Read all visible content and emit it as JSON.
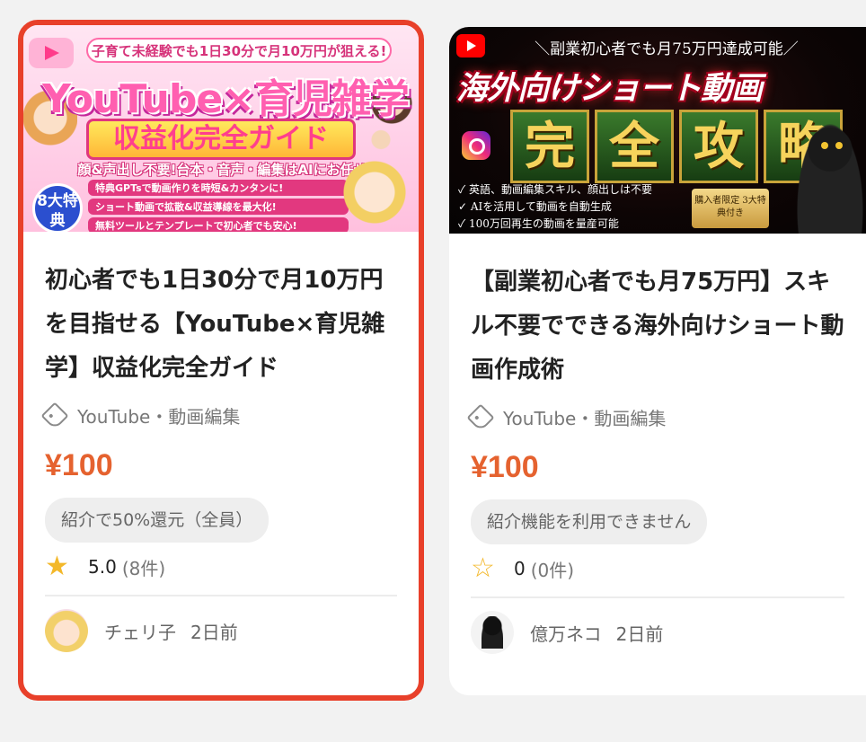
{
  "cards": [
    {
      "selected": true,
      "thumbnail": {
        "top_line": "子育て未経験でも1日30分で月10万円が狙える!",
        "headline": "YouTube×育児雑学",
        "subheadline": "収益化完全ガイド",
        "tagline": "顔&声出し不要!台本・音声・編集はAIにお任せ!",
        "badge": "8大特典",
        "bullets": [
          "特典GPTsで動画作りを時短&カンタンに!",
          "ショート動画で拡散&収益導線を最大化!",
          "無料ツールとテンプレートで初心者でも安心!"
        ]
      },
      "title": "初心者でも1日30分で月10万円を目指せる【YouTube×育児雑学】収益化完全ガイド",
      "tags": "YouTube・動画編集",
      "price": "¥100",
      "referral": "紹介で50%還元（全員）",
      "rating": {
        "score": "5.0",
        "count": "(8件)",
        "filled": true
      },
      "author": {
        "name": "チェリ子",
        "time": "2日前"
      }
    },
    {
      "selected": false,
      "thumbnail": {
        "top_line": "＼副業初心者でも月75万円達成可能／",
        "headline": "海外向けショート動画",
        "tiles": [
          "完",
          "全",
          "攻",
          "略"
        ],
        "notes": [
          "✓ 英語、動画編集スキル、顔出しは不要",
          "✓ AIを活用して動画を自動生成",
          "✓ 100万回再生の動画を量産可能"
        ],
        "badge": "購入者限定 3大特典付き"
      },
      "title": "【副業初心者でも月75万円】スキル不要でできる海外向けショート動画作成術",
      "tags": "YouTube・動画編集",
      "price": "¥100",
      "referral": "紹介機能を利用できません",
      "rating": {
        "score": "0",
        "count": "(0件)",
        "filled": false
      },
      "author": {
        "name": "億万ネコ",
        "time": "2日前"
      }
    }
  ],
  "colors": {
    "selected_border": "#e8402a",
    "price": "#e5622f",
    "star": "#f3b82a"
  },
  "icons": {
    "tag": "tag-icon",
    "star_filled": "star-filled-icon",
    "star_empty": "star-outline-icon"
  }
}
